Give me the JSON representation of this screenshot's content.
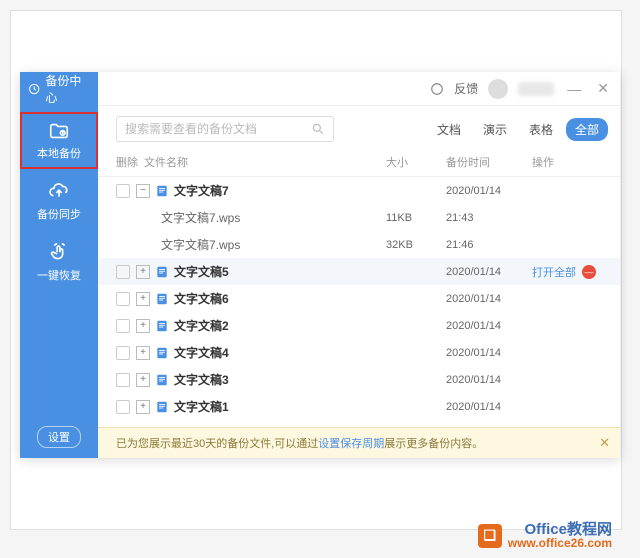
{
  "window": {
    "title": "备份中心",
    "feedback": "反馈",
    "minimize": "—",
    "close": "✕"
  },
  "sidebar": {
    "local": "本地备份",
    "sync": "备份同步",
    "restore": "一键恢复",
    "settings": "设置"
  },
  "search": {
    "placeholder": "搜索需要查看的备份文档"
  },
  "filters": {
    "doc": "文档",
    "pres": "演示",
    "sheet": "表格",
    "all": "全部"
  },
  "columns": {
    "delete": "删除",
    "name": "文件名称",
    "size": "大小",
    "time": "备份时间",
    "op": "操作"
  },
  "actions": {
    "open_all": "打开全部"
  },
  "rows": [
    {
      "type": "group",
      "expanded": true,
      "name": "文字文稿7",
      "time": "2020/01/14"
    },
    {
      "type": "child",
      "name": "文字文稿7.wps",
      "size": "11KB",
      "time": "21:43"
    },
    {
      "type": "child",
      "name": "文字文稿7.wps",
      "size": "32KB",
      "time": "21:46"
    },
    {
      "type": "group",
      "expanded": false,
      "hover": true,
      "name": "文字文稿5",
      "time": "2020/01/14",
      "op": true
    },
    {
      "type": "group",
      "expanded": false,
      "name": "文字文稿6",
      "time": "2020/01/14"
    },
    {
      "type": "group",
      "expanded": false,
      "name": "文字文稿2",
      "time": "2020/01/14"
    },
    {
      "type": "group",
      "expanded": false,
      "name": "文字文稿4",
      "time": "2020/01/14"
    },
    {
      "type": "group",
      "expanded": false,
      "name": "文字文稿3",
      "time": "2020/01/14"
    },
    {
      "type": "group",
      "expanded": false,
      "name": "文字文稿1",
      "time": "2020/01/14"
    }
  ],
  "footer": {
    "pre": "已为您展示最近30天的备份文件,可以通过 ",
    "link": "设置保存周期",
    "post": " 展示更多备份内容。"
  },
  "brand": {
    "cn": "Office教程网",
    "url": "www.office26.com"
  }
}
